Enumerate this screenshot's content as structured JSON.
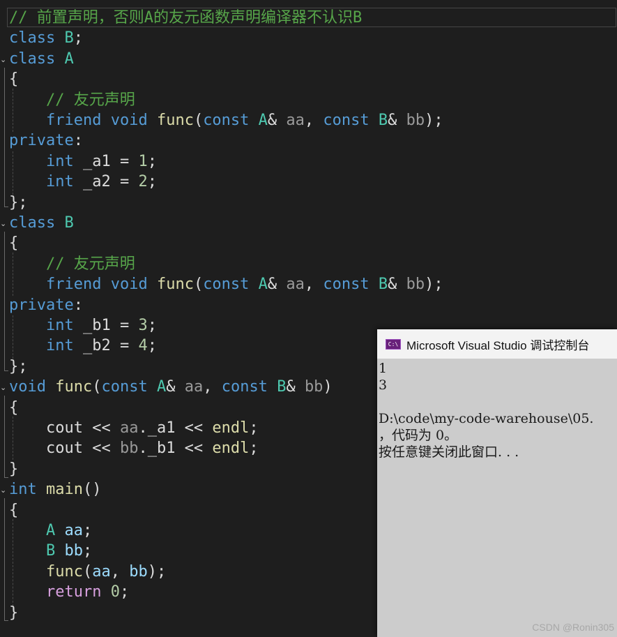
{
  "editor": {
    "lines": [
      [
        [
          "cm",
          "// 前置声明，否则A的友元函数声明编译器不认识B"
        ]
      ],
      [
        [
          "kw",
          "class"
        ],
        [
          "pl",
          " "
        ],
        [
          "cls",
          "B"
        ],
        [
          "pl",
          ";"
        ]
      ],
      [
        [
          "kw",
          "class"
        ],
        [
          "pl",
          " "
        ],
        [
          "cls",
          "A"
        ]
      ],
      [
        [
          "pl",
          "{"
        ]
      ],
      [
        [
          "pl",
          "    "
        ],
        [
          "cm",
          "// 友元声明"
        ]
      ],
      [
        [
          "pl",
          "    "
        ],
        [
          "kw",
          "friend"
        ],
        [
          "pl",
          " "
        ],
        [
          "kw",
          "void"
        ],
        [
          "pl",
          " "
        ],
        [
          "fn",
          "func"
        ],
        [
          "pl",
          "("
        ],
        [
          "kw",
          "const"
        ],
        [
          "pl",
          " "
        ],
        [
          "cls",
          "A"
        ],
        [
          "pl",
          "& "
        ],
        [
          "pm",
          "aa"
        ],
        [
          "pl",
          ", "
        ],
        [
          "kw",
          "const"
        ],
        [
          "pl",
          " "
        ],
        [
          "cls",
          "B"
        ],
        [
          "pl",
          "& "
        ],
        [
          "pm",
          "bb"
        ],
        [
          "pl",
          ");"
        ]
      ],
      [
        [
          "kw",
          "private"
        ],
        [
          "pl",
          ":"
        ]
      ],
      [
        [
          "pl",
          "    "
        ],
        [
          "kw",
          "int"
        ],
        [
          "pl",
          " _a1 = "
        ],
        [
          "num",
          "1"
        ],
        [
          "pl",
          ";"
        ]
      ],
      [
        [
          "pl",
          "    "
        ],
        [
          "kw",
          "int"
        ],
        [
          "pl",
          " _a2 = "
        ],
        [
          "num",
          "2"
        ],
        [
          "pl",
          ";"
        ]
      ],
      [
        [
          "pl",
          "};"
        ]
      ],
      [
        [
          "kw",
          "class"
        ],
        [
          "pl",
          " "
        ],
        [
          "cls",
          "B"
        ]
      ],
      [
        [
          "pl",
          "{"
        ]
      ],
      [
        [
          "pl",
          "    "
        ],
        [
          "cm",
          "// 友元声明"
        ]
      ],
      [
        [
          "pl",
          "    "
        ],
        [
          "kw",
          "friend"
        ],
        [
          "pl",
          " "
        ],
        [
          "kw",
          "void"
        ],
        [
          "pl",
          " "
        ],
        [
          "fn",
          "func"
        ],
        [
          "pl",
          "("
        ],
        [
          "kw",
          "const"
        ],
        [
          "pl",
          " "
        ],
        [
          "cls",
          "A"
        ],
        [
          "pl",
          "& "
        ],
        [
          "pm",
          "aa"
        ],
        [
          "pl",
          ", "
        ],
        [
          "kw",
          "const"
        ],
        [
          "pl",
          " "
        ],
        [
          "cls",
          "B"
        ],
        [
          "pl",
          "& "
        ],
        [
          "pm",
          "bb"
        ],
        [
          "pl",
          ");"
        ]
      ],
      [
        [
          "kw",
          "private"
        ],
        [
          "pl",
          ":"
        ]
      ],
      [
        [
          "pl",
          "    "
        ],
        [
          "kw",
          "int"
        ],
        [
          "pl",
          " _b1 = "
        ],
        [
          "num",
          "3"
        ],
        [
          "pl",
          ";"
        ]
      ],
      [
        [
          "pl",
          "    "
        ],
        [
          "kw",
          "int"
        ],
        [
          "pl",
          " _b2 = "
        ],
        [
          "num",
          "4"
        ],
        [
          "pl",
          ";"
        ]
      ],
      [
        [
          "pl",
          "};"
        ]
      ],
      [
        [
          "kw",
          "void"
        ],
        [
          "pl",
          " "
        ],
        [
          "fn",
          "func"
        ],
        [
          "pl",
          "("
        ],
        [
          "kw",
          "const"
        ],
        [
          "pl",
          " "
        ],
        [
          "cls",
          "A"
        ],
        [
          "pl",
          "& "
        ],
        [
          "pm",
          "aa"
        ],
        [
          "pl",
          ", "
        ],
        [
          "kw",
          "const"
        ],
        [
          "pl",
          " "
        ],
        [
          "cls",
          "B"
        ],
        [
          "pl",
          "& "
        ],
        [
          "pm",
          "bb"
        ],
        [
          "pl",
          ")"
        ]
      ],
      [
        [
          "pl",
          "{"
        ]
      ],
      [
        [
          "pl",
          "    cout << "
        ],
        [
          "pm",
          "aa"
        ],
        [
          "pl",
          "._a1 << "
        ],
        [
          "fn",
          "endl"
        ],
        [
          "pl",
          ";"
        ]
      ],
      [
        [
          "pl",
          "    cout << "
        ],
        [
          "pm",
          "bb"
        ],
        [
          "pl",
          "._b1 << "
        ],
        [
          "fn",
          "endl"
        ],
        [
          "pl",
          ";"
        ]
      ],
      [
        [
          "pl",
          "}"
        ]
      ],
      [
        [
          "kw",
          "int"
        ],
        [
          "pl",
          " "
        ],
        [
          "fn",
          "main"
        ],
        [
          "pl",
          "()"
        ]
      ],
      [
        [
          "pl",
          "{"
        ]
      ],
      [
        [
          "pl",
          "    "
        ],
        [
          "cls",
          "A"
        ],
        [
          "pl",
          " "
        ],
        [
          "lv",
          "aa"
        ],
        [
          "pl",
          ";"
        ]
      ],
      [
        [
          "pl",
          "    "
        ],
        [
          "cls",
          "B"
        ],
        [
          "pl",
          " "
        ],
        [
          "lv",
          "bb"
        ],
        [
          "pl",
          ";"
        ]
      ],
      [
        [
          "pl",
          "    "
        ],
        [
          "fn",
          "func"
        ],
        [
          "pl",
          "("
        ],
        [
          "lv",
          "aa"
        ],
        [
          "pl",
          ", "
        ],
        [
          "lv",
          "bb"
        ],
        [
          "pl",
          ");"
        ]
      ],
      [
        [
          "pl",
          "    "
        ],
        [
          "ctl",
          "return"
        ],
        [
          "pl",
          " "
        ],
        [
          "num",
          "0"
        ],
        [
          "pl",
          ";"
        ]
      ],
      [
        [
          "pl",
          "}"
        ]
      ]
    ],
    "fold_marker": "⌄"
  },
  "console": {
    "title": "Microsoft Visual Studio 调试控制台",
    "icon_label": "C:\\",
    "output": [
      "1",
      "3",
      "",
      "D:\\code\\my-code-warehouse\\05.",
      "，代码为 0。",
      "按任意键关闭此窗口. . ."
    ]
  },
  "watermark": "CSDN @Ronin305",
  "colors": {
    "background": "#1e1e1e",
    "keyword": "#569cd6",
    "class": "#4ec9b0",
    "function": "#dcdcaa",
    "comment": "#57a64a",
    "number": "#b5cea8",
    "control": "#d8a0df",
    "console_background": "#cccccc"
  }
}
